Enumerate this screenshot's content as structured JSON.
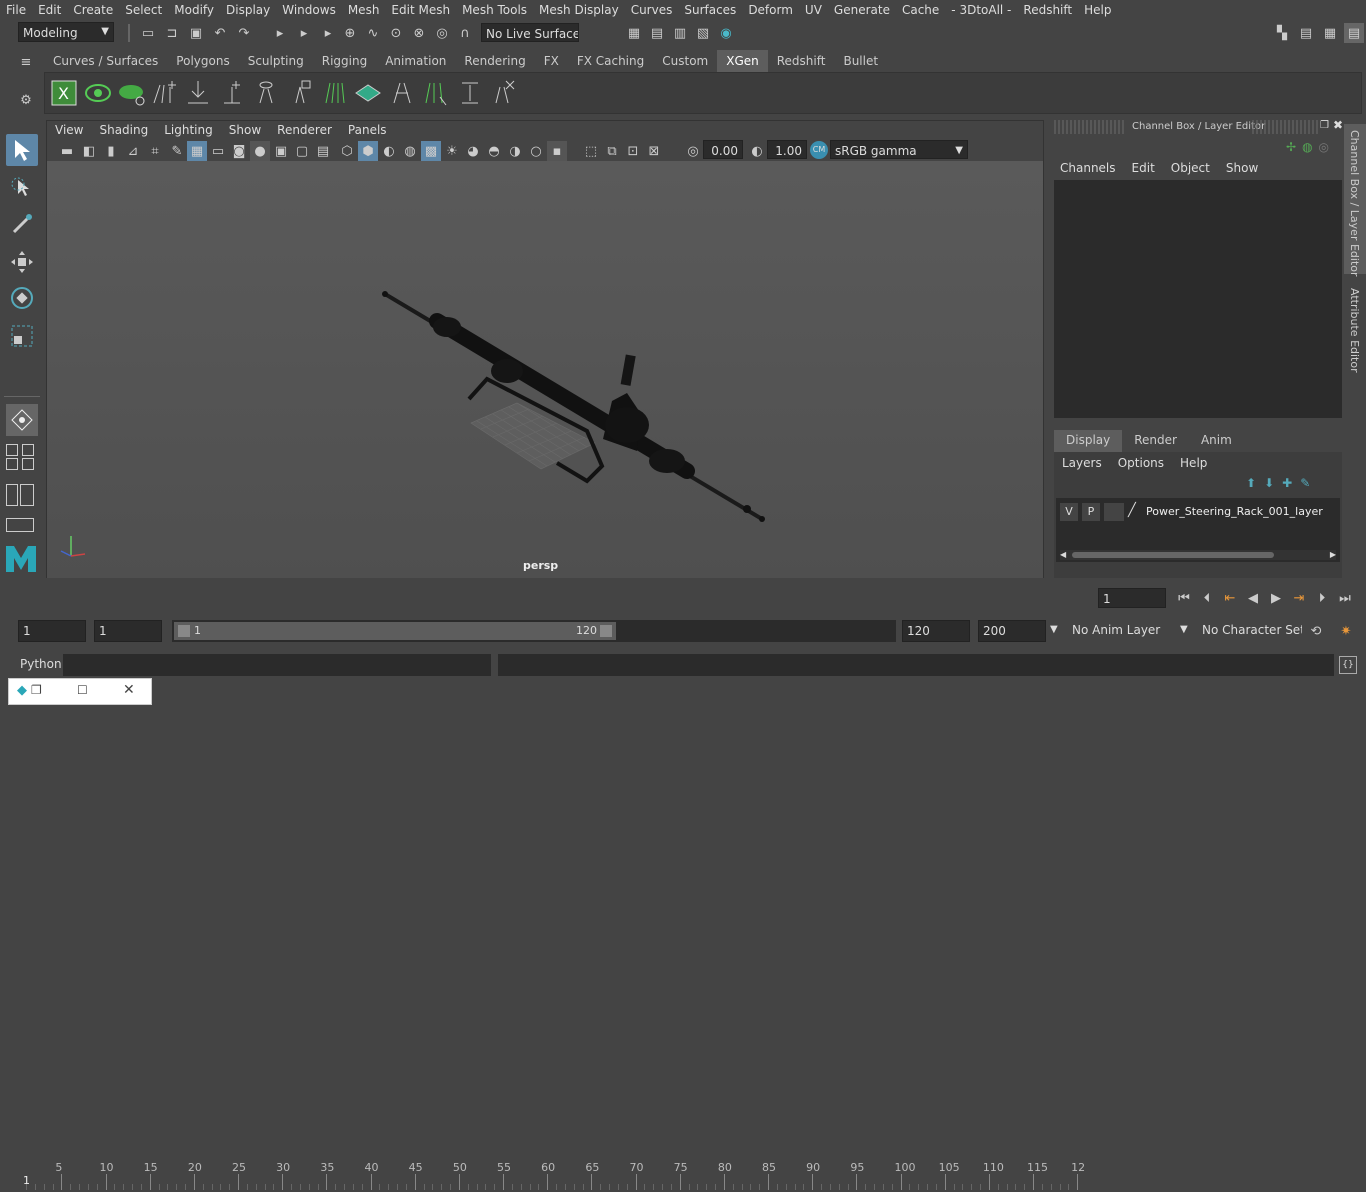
{
  "menu": [
    "File",
    "Edit",
    "Create",
    "Select",
    "Modify",
    "Display",
    "Windows",
    "Mesh",
    "Edit Mesh",
    "Mesh Tools",
    "Mesh Display",
    "Curves",
    "Surfaces",
    "Deform",
    "UV",
    "Generate",
    "Cache",
    "- 3DtoAll -",
    "Redshift",
    "Help"
  ],
  "status": {
    "mode": "Modeling",
    "live_surface": "No Live Surface"
  },
  "shelf_tabs": [
    "Curves / Surfaces",
    "Polygons",
    "Sculpting",
    "Rigging",
    "Animation",
    "Rendering",
    "FX",
    "FX Caching",
    "Custom",
    "XGen",
    "Redshift",
    "Bullet"
  ],
  "shelf_active": "XGen",
  "viewport": {
    "menu": [
      "View",
      "Shading",
      "Lighting",
      "Show",
      "Renderer",
      "Panels"
    ],
    "exposure": "0.00",
    "gamma": "1.00",
    "color_space": "sRGB gamma",
    "camera": "persp"
  },
  "channel_box": {
    "title": "Channel Box / Layer Editor",
    "menu": [
      "Channels",
      "Edit",
      "Object",
      "Show"
    ]
  },
  "layer_editor": {
    "tabs": [
      "Display",
      "Render",
      "Anim"
    ],
    "active_tab": "Display",
    "menu": [
      "Layers",
      "Options",
      "Help"
    ],
    "layer": {
      "v": "V",
      "p": "P",
      "name": "Power_Steering_Rack_001_layer"
    }
  },
  "side_tabs": [
    "Channel Box / Layer Editor",
    "Attribute Editor"
  ],
  "timeline": {
    "ticks": [
      "5",
      "10",
      "15",
      "20",
      "25",
      "30",
      "35",
      "40",
      "45",
      "50",
      "55",
      "60",
      "65",
      "70",
      "75",
      "80",
      "85",
      "90",
      "95",
      "100",
      "105",
      "110",
      "115",
      "12"
    ],
    "start_mark": "1",
    "current_frame": "1"
  },
  "range": {
    "start": "1",
    "playback_start": "1",
    "slider_start": "1",
    "slider_end": "120",
    "playback_end": "120",
    "end": "200",
    "anim_layer": "No Anim Layer",
    "char_set": "No Character Set"
  },
  "command": {
    "label": "Python"
  }
}
